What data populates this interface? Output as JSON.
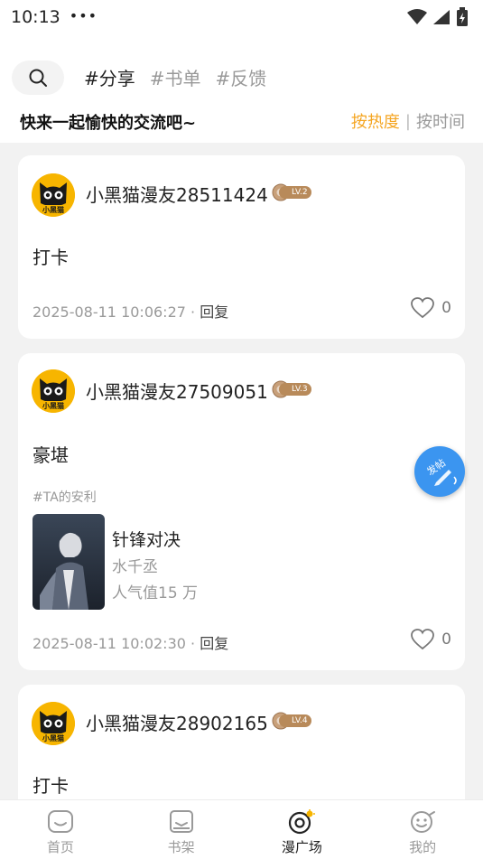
{
  "status": {
    "time": "10:13",
    "dots": "•••"
  },
  "header": {
    "tags": [
      "#分享",
      "#书单",
      "#反馈"
    ],
    "slogan": "快来一起愉快的交流吧~",
    "sort_hot": "按热度",
    "sort_sep": "|",
    "sort_time": "按时间"
  },
  "posts": [
    {
      "user": "小黑猫漫友28511424",
      "level": "LV.2",
      "text": "打卡",
      "time": "2025-08-11 10:06:27 ·",
      "reply": "回复",
      "likes": "0"
    },
    {
      "user": "小黑猫漫友27509051",
      "level": "LV.3",
      "text": "豪堪",
      "book_tag": "#TA的安利",
      "book_title": "针锋对决",
      "book_author": "水千丞",
      "book_pop": "人气值15 万",
      "time": "2025-08-11 10:02:30 ·",
      "reply": "回复",
      "likes": "0"
    },
    {
      "user": "小黑猫漫友28902165",
      "level": "LV.4",
      "text": "打卡"
    }
  ],
  "avatar_caption": "小黑猫",
  "fab_label": "发帖",
  "nav": [
    {
      "label": "首页",
      "icon": "home-icon"
    },
    {
      "label": "书架",
      "icon": "bookshelf-icon"
    },
    {
      "label": "漫广场",
      "icon": "plaza-icon"
    },
    {
      "label": "我的",
      "icon": "profile-icon"
    }
  ],
  "colors": {
    "accent": "#f5a623",
    "fab": "#3b95f0",
    "avatar_bg": "#f7b500"
  }
}
